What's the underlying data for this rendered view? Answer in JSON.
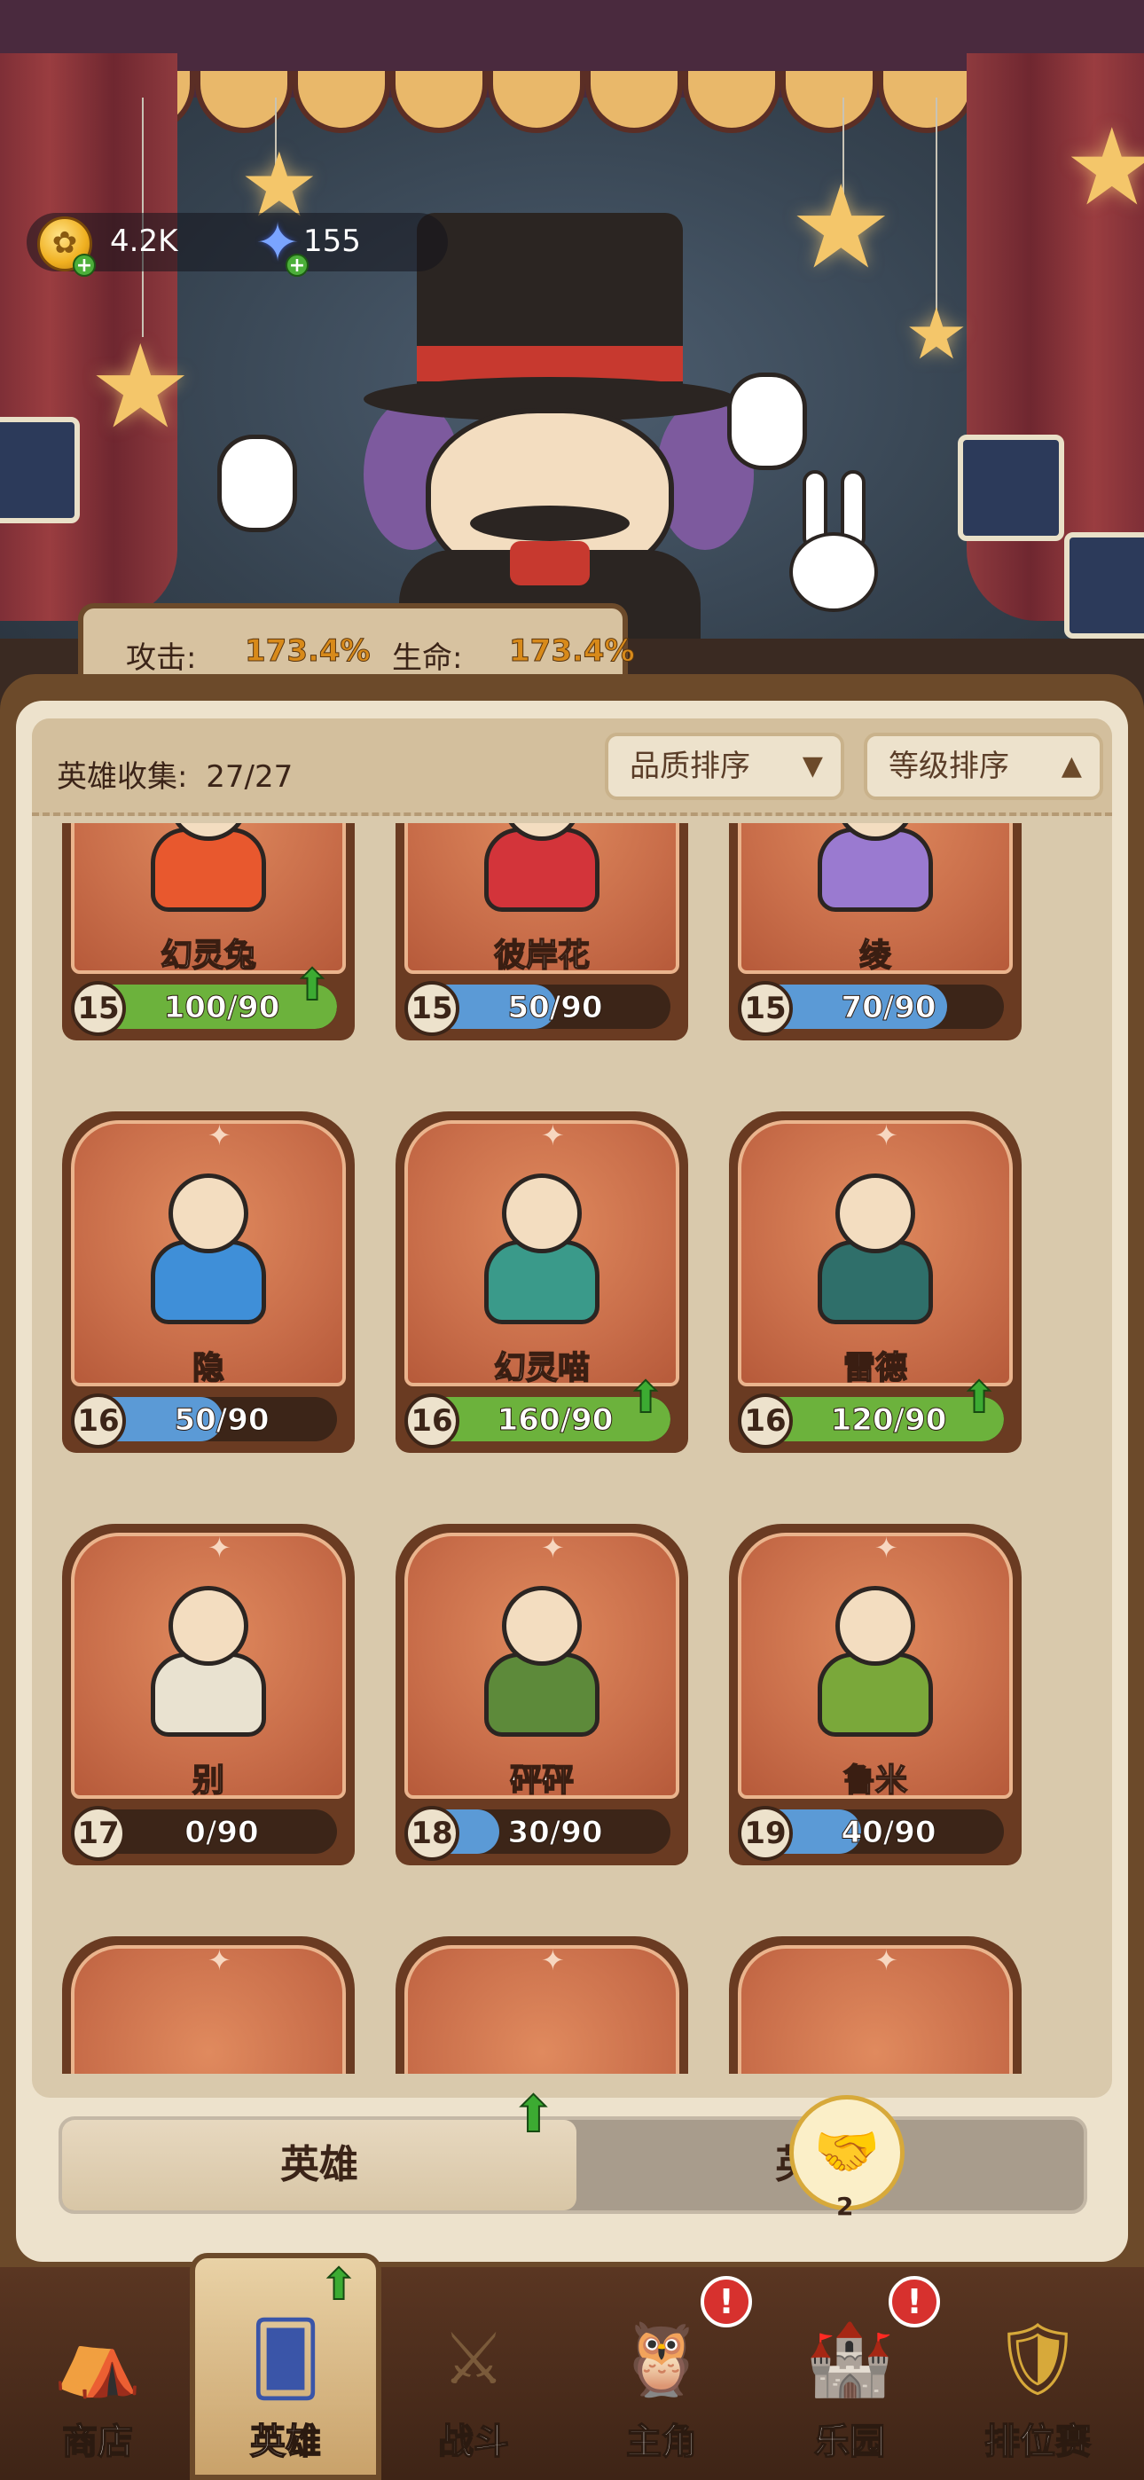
{
  "resources": {
    "coins": "4.2K",
    "gems": "155"
  },
  "bonus": {
    "attack_label": "攻击:",
    "attack_value": "173.4%",
    "life_label": "生命:",
    "life_value": "173.4%"
  },
  "collection": {
    "label": "英雄收集:",
    "value": "27/27"
  },
  "sort": {
    "quality": "品质排序",
    "quality_arrow": "▼",
    "level": "等级排序",
    "level_arrow": "▲"
  },
  "heroes": [
    {
      "name": "幻灵兔",
      "level": "15",
      "progress": "100/90",
      "fill": 1.0,
      "upgrade": true,
      "color": "#e8582e"
    },
    {
      "name": "彼岸花",
      "level": "15",
      "progress": "50/90",
      "fill": 0.556,
      "upgrade": false,
      "color": "#d3343a"
    },
    {
      "name": "绫",
      "level": "15",
      "progress": "70/90",
      "fill": 0.778,
      "upgrade": false,
      "color": "#9a7ad0"
    },
    {
      "name": "隐",
      "level": "16",
      "progress": "50/90",
      "fill": 0.556,
      "upgrade": false,
      "color": "#3f8fd8"
    },
    {
      "name": "幻灵喵",
      "level": "16",
      "progress": "160/90",
      "fill": 1.0,
      "upgrade": true,
      "color": "#3a9a8a"
    },
    {
      "name": "雷德",
      "level": "16",
      "progress": "120/90",
      "fill": 1.0,
      "upgrade": true,
      "color": "#2f6f6a"
    },
    {
      "name": "别",
      "level": "17",
      "progress": "0/90",
      "fill": 0.0,
      "upgrade": false,
      "color": "#e9e2d0"
    },
    {
      "name": "砰砰",
      "level": "18",
      "progress": "30/90",
      "fill": 0.333,
      "upgrade": false,
      "color": "#5d8a3a"
    },
    {
      "name": "鲁米",
      "level": "19",
      "progress": "40/90",
      "fill": 0.444,
      "upgrade": false,
      "color": "#7aa83a"
    }
  ],
  "tabs": {
    "active": "英雄",
    "other": "英雄签"
  },
  "handshake_count": "2",
  "nav": [
    {
      "label": "商店",
      "icon": "shop-tent-icon"
    },
    {
      "label": "英雄",
      "icon": "hero-cards-icon"
    },
    {
      "label": "战斗",
      "icon": "battle-swords-icon"
    },
    {
      "label": "主角",
      "icon": "owl-protagonist-icon"
    },
    {
      "label": "乐园",
      "icon": "castle-park-icon"
    },
    {
      "label": "排位赛",
      "icon": "rank-badge-icon"
    }
  ],
  "colors": {
    "progress_green": "#6cb23c",
    "progress_blue": "#5b9ad6",
    "accent_orange": "#d88a1a"
  }
}
